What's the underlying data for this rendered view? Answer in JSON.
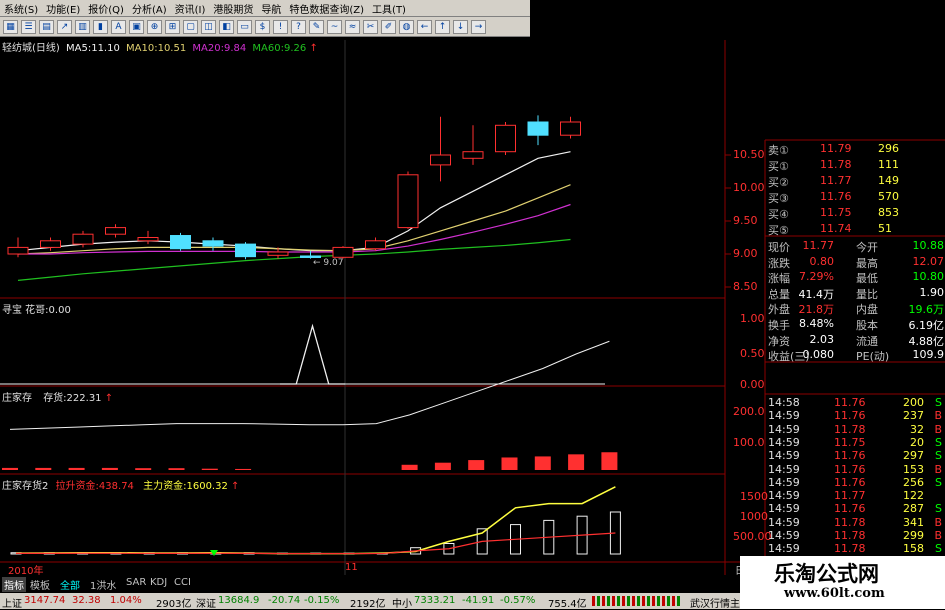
{
  "menu": [
    "系统(S)",
    "功能(E)",
    "报价(Q)",
    "分析(A)",
    "资讯(I)",
    "港股期货",
    "导航",
    "特色数据查询(Z)",
    "工具(T)"
  ],
  "chart_title": {
    "name": "轻纺城(日线)",
    "ma5": "MA5:11.10",
    "ma10": "MA10:10.51",
    "ma20": "MA20:9.84",
    "ma60": "MA60:9.26",
    "arrow": "↑"
  },
  "colors": {
    "ma5": "#f0f0f0",
    "ma10": "#e0d070",
    "ma20": "#d030d0",
    "ma60": "#20c020",
    "up": "#ff3030",
    "down": "#50e0ff",
    "grid": "#8b0000",
    "yellow": "#ffff40",
    "red": "#ff3030",
    "green": "#00ff00",
    "white": "#f0f0f0"
  },
  "chart_data": [
    {
      "type": "candlestick",
      "title": "轻纺城(日线)",
      "y_ticks": [
        "10.50",
        "10.00",
        "9.50",
        "9.00",
        "8.50"
      ],
      "annotation": "← 9.07",
      "candles": [
        {
          "o": 9.0,
          "h": 9.25,
          "l": 8.95,
          "c": 9.1
        },
        {
          "o": 9.1,
          "h": 9.25,
          "l": 9.05,
          "c": 9.2
        },
        {
          "o": 9.15,
          "h": 9.35,
          "l": 9.1,
          "c": 9.3
        },
        {
          "o": 9.3,
          "h": 9.45,
          "l": 9.25,
          "c": 9.4
        },
        {
          "o": 9.2,
          "h": 9.35,
          "l": 9.15,
          "c": 9.25
        },
        {
          "o": 9.28,
          "h": 9.32,
          "l": 9.05,
          "c": 9.08
        },
        {
          "o": 9.2,
          "h": 9.25,
          "l": 9.05,
          "c": 9.12
        },
        {
          "o": 9.15,
          "h": 9.18,
          "l": 8.92,
          "c": 8.96
        },
        {
          "o": 8.98,
          "h": 9.1,
          "l": 8.93,
          "c": 9.03
        },
        {
          "o": 8.97,
          "h": 9.05,
          "l": 8.93,
          "c": 8.95
        },
        {
          "o": 8.95,
          "h": 9.12,
          "l": 8.93,
          "c": 9.1
        },
        {
          "o": 9.08,
          "h": 9.25,
          "l": 9.05,
          "c": 9.2
        },
        {
          "o": 9.4,
          "h": 10.25,
          "l": 9.38,
          "c": 10.2
        },
        {
          "o": 10.35,
          "h": 11.08,
          "l": 10.1,
          "c": 10.5
        },
        {
          "o": 10.45,
          "h": 10.95,
          "l": 10.35,
          "c": 10.55
        },
        {
          "o": 10.55,
          "h": 11.0,
          "l": 10.5,
          "c": 10.95
        },
        {
          "o": 11.0,
          "h": 11.1,
          "l": 10.65,
          "c": 10.8
        },
        {
          "o": 10.8,
          "h": 11.08,
          "l": 10.75,
          "c": 11.0
        }
      ],
      "series": [
        {
          "name": "MA5",
          "values": [
            9.05,
            9.1,
            9.15,
            9.18,
            9.2,
            9.18,
            9.15,
            9.12,
            9.08,
            9.05,
            9.05,
            9.1,
            9.35,
            9.7,
            9.95,
            10.2,
            10.45,
            10.55
          ]
        },
        {
          "name": "MA10",
          "values": [
            9.0,
            9.02,
            9.05,
            9.08,
            9.1,
            9.1,
            9.1,
            9.1,
            9.08,
            9.06,
            9.05,
            9.08,
            9.2,
            9.35,
            9.5,
            9.65,
            9.85,
            10.05
          ]
        },
        {
          "name": "MA20",
          "values": [
            9.0,
            9.0,
            9.02,
            9.03,
            9.04,
            9.04,
            9.04,
            9.04,
            9.03,
            9.03,
            9.03,
            9.05,
            9.12,
            9.22,
            9.33,
            9.45,
            9.58,
            9.75
          ]
        },
        {
          "name": "MA60",
          "values": [
            8.6,
            8.65,
            8.7,
            8.74,
            8.78,
            8.82,
            8.86,
            8.9,
            8.93,
            8.96,
            8.98,
            9.0,
            9.03,
            9.07,
            9.1,
            9.13,
            9.17,
            9.22
          ]
        }
      ]
    },
    {
      "type": "line",
      "title": "寻宝 花哥:0.00",
      "y_ticks": [
        "1.00",
        "0.50",
        "0.00"
      ],
      "values": [
        0,
        0,
        0,
        0,
        0,
        0,
        0,
        0,
        0,
        1,
        0,
        0,
        0,
        0,
        0,
        0,
        0,
        0,
        0
      ]
    },
    {
      "type": "bar",
      "title": "庄家存 存货:222.31",
      "y_ticks": [
        "200.0",
        "100.0"
      ],
      "line_values": [
        70,
        72,
        74,
        76,
        78,
        80,
        80,
        80,
        79,
        78,
        78,
        80,
        95,
        115,
        135,
        155,
        175,
        200,
        222
      ],
      "bar_values": [
        8,
        8,
        8,
        8,
        7,
        7,
        5,
        4,
        0,
        0,
        0,
        0,
        20,
        28,
        38,
        48,
        52,
        60,
        68
      ]
    },
    {
      "type": "bar",
      "title": "庄家存货2 拉升资金:438.74 主力资金:1600.32",
      "y_ticks": [
        "1500",
        "1000",
        "500.00"
      ],
      "line_values": [
        20,
        25,
        30,
        30,
        25,
        25,
        30,
        20,
        10,
        10,
        10,
        20,
        60,
        300,
        500,
        1100,
        1200,
        1200,
        1600
      ],
      "bar_values": [
        30,
        30,
        35,
        35,
        30,
        30,
        35,
        30,
        20,
        20,
        20,
        20,
        150,
        250,
        600,
        700,
        800,
        900,
        1000
      ]
    }
  ],
  "indicator_titles": {
    "xunbao": "寻宝 花哥:0.00",
    "zjc_name": "庄家存",
    "zjc_value": "存货:222.31",
    "zjc2_name": "庄家存货2",
    "zjc2_lift": "拉升资金:438.74",
    "zjc2_main": "主力资金:1600.32"
  },
  "xaxis": {
    "left": "2010年",
    "mid": "11",
    "right": "日线"
  },
  "order_book": [
    {
      "label": "卖①",
      "price": "11.79",
      "vol": "296"
    },
    {
      "label": "买①",
      "price": "11.78",
      "vol": "111"
    },
    {
      "label": "买②",
      "price": "11.77",
      "vol": "149"
    },
    {
      "label": "买③",
      "price": "11.76",
      "vol": "570"
    },
    {
      "label": "买④",
      "price": "11.75",
      "vol": "853"
    },
    {
      "label": "买⑤",
      "price": "11.74",
      "vol": "51"
    }
  ],
  "quote": [
    {
      "l1": "现价",
      "v1": "11.77",
      "l2": "今开",
      "v2": "10.88"
    },
    {
      "l1": "涨跌",
      "v1": "0.80",
      "l2": "最高",
      "v2": "12.07"
    },
    {
      "l1": "涨幅",
      "v1": "7.29%",
      "l2": "最低",
      "v2": "10.80"
    },
    {
      "l1": "总量",
      "v1": "41.4万",
      "l2": "量比",
      "v2": "1.90"
    },
    {
      "l1": "外盘",
      "v1": "21.8万",
      "l2": "内盘",
      "v2": "19.6万"
    },
    {
      "l1": "换手",
      "v1": "8.48%",
      "l2": "股本",
      "v2": "6.19亿"
    },
    {
      "l1": "净资",
      "v1": "2.03",
      "l2": "流通",
      "v2": "4.88亿"
    },
    {
      "l1": "收益(三)",
      "v1": "0.080",
      "l2": "PE(动)",
      "v2": "109.9"
    }
  ],
  "ticks": [
    {
      "t": "14:58",
      "p": "11.76",
      "v": "200",
      "s": "S"
    },
    {
      "t": "14:59",
      "p": "11.76",
      "v": "237",
      "s": "B"
    },
    {
      "t": "14:59",
      "p": "11.78",
      "v": "32",
      "s": "B"
    },
    {
      "t": "14:59",
      "p": "11.75",
      "v": "20",
      "s": "S"
    },
    {
      "t": "14:59",
      "p": "11.76",
      "v": "297",
      "s": "S"
    },
    {
      "t": "14:59",
      "p": "11.76",
      "v": "153",
      "s": "B"
    },
    {
      "t": "14:59",
      "p": "11.76",
      "v": "256",
      "s": "S"
    },
    {
      "t": "14:59",
      "p": "11.77",
      "v": "122",
      "s": ""
    },
    {
      "t": "14:59",
      "p": "11.76",
      "v": "287",
      "s": "S"
    },
    {
      "t": "14:59",
      "p": "11.78",
      "v": "341",
      "s": "B"
    },
    {
      "t": "14:59",
      "p": "11.78",
      "v": "299",
      "s": "B"
    },
    {
      "t": "14:59",
      "p": "11.78",
      "v": "158",
      "s": "S"
    }
  ],
  "bottom_tabs": [
    "指标",
    "模板",
    "全部",
    "1洪水",
    "SAR",
    "KDJ",
    "CCI"
  ],
  "statusbar": {
    "sh": "上证",
    "sh_idx": "3147.74",
    "sh_chg": "32.38",
    "sh_pct": "1.04%",
    "sh_amt": "2903亿",
    "sz": "深证",
    "sz_idx": "13684.9",
    "sz_chg": "-20.74",
    "sz_pct": "-0.15%",
    "sz_amt": "2192亿",
    "zx": "中小",
    "zx_idx": "7333.21",
    "zx_chg": "-41.91",
    "zx_pct": "-0.57%",
    "zx_amt": "755.4亿",
    "station": "武汉行情主站"
  },
  "watermark": {
    "line1": "乐淘公式网",
    "line2": "www.60lt.com"
  }
}
